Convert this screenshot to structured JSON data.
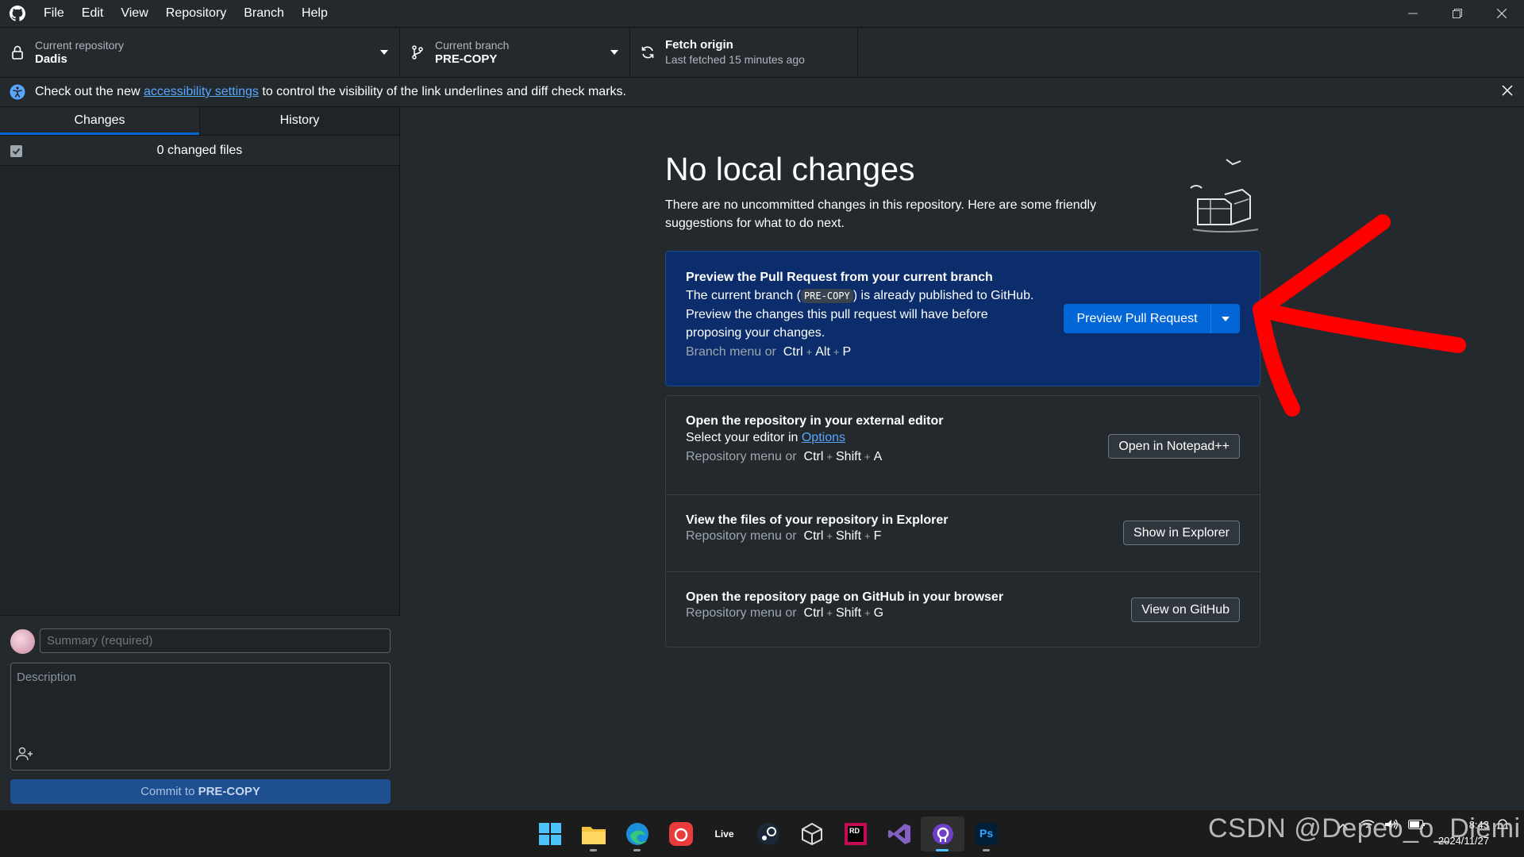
{
  "menu": [
    "File",
    "Edit",
    "View",
    "Repository",
    "Branch",
    "Help"
  ],
  "toolbar": {
    "repo_label": "Current repository",
    "repo_value": "Dadis",
    "branch_label": "Current branch",
    "branch_value": "PRE-COPY",
    "fetch_label": "Fetch origin",
    "fetch_sub": "Last fetched 15 minutes ago"
  },
  "banner": {
    "pre": "Check out the new ",
    "link": "accessibility settings",
    "post": " to control the visibility of the link underlines and diff check marks."
  },
  "sidebar": {
    "tabs": [
      "Changes",
      "History"
    ],
    "files_count": "0 changed files",
    "summary_placeholder": "Summary (required)",
    "description_placeholder": "Description",
    "commit_pre": "Commit to ",
    "commit_branch": "PRE-COPY"
  },
  "main": {
    "heading": "No local changes",
    "intro": "There are no uncommitted changes in this repository. Here are some friendly suggestions for what to do next.",
    "pr_card": {
      "title": "Preview the Pull Request from your current branch",
      "desc_pre": "The current branch (",
      "desc_code": "PRE-COPY",
      "desc_post": ") is already published to GitHub.",
      "desc_line2": "Preview the changes this pull request will have before",
      "desc_line3": "proposing your changes.",
      "shortcut_pre": "Branch menu or",
      "keys": [
        "Ctrl",
        "Alt",
        "P"
      ],
      "button": "Preview Pull Request"
    },
    "editor_card": {
      "title": "Open the repository in your external editor",
      "desc_pre": "Select your editor in ",
      "desc_link": "Options",
      "shortcut_pre": "Repository menu or",
      "keys": [
        "Ctrl",
        "Shift",
        "A"
      ],
      "button": "Open in Notepad++"
    },
    "explorer_card": {
      "title": "View the files of your repository in Explorer",
      "shortcut_pre": "Repository menu or",
      "keys": [
        "Ctrl",
        "Shift",
        "F"
      ],
      "button": "Show in Explorer"
    },
    "github_card": {
      "title": "Open the repository page on GitHub in your browser",
      "shortcut_pre": "Repository menu or",
      "keys": [
        "Ctrl",
        "Shift",
        "G"
      ],
      "button": "View on GitHub"
    }
  },
  "taskbar": {
    "apps": [
      "windows-start-icon",
      "file-explorer-icon",
      "edge-icon",
      "netease-music-icon",
      "live-icon",
      "steam-icon",
      "unity-icon",
      "rider-icon",
      "visual-studio-icon",
      "github-desktop-icon",
      "photoshop-icon"
    ],
    "live_label": "Live",
    "rider_label": "RD",
    "ps_label": "Ps",
    "time": "8:43",
    "date": "2024/11/27"
  },
  "watermark": "CSDN @Depeo_o_Diemi",
  "colors": {
    "accent": "#0366d6",
    "annotation_arrow": "#ff0000"
  }
}
